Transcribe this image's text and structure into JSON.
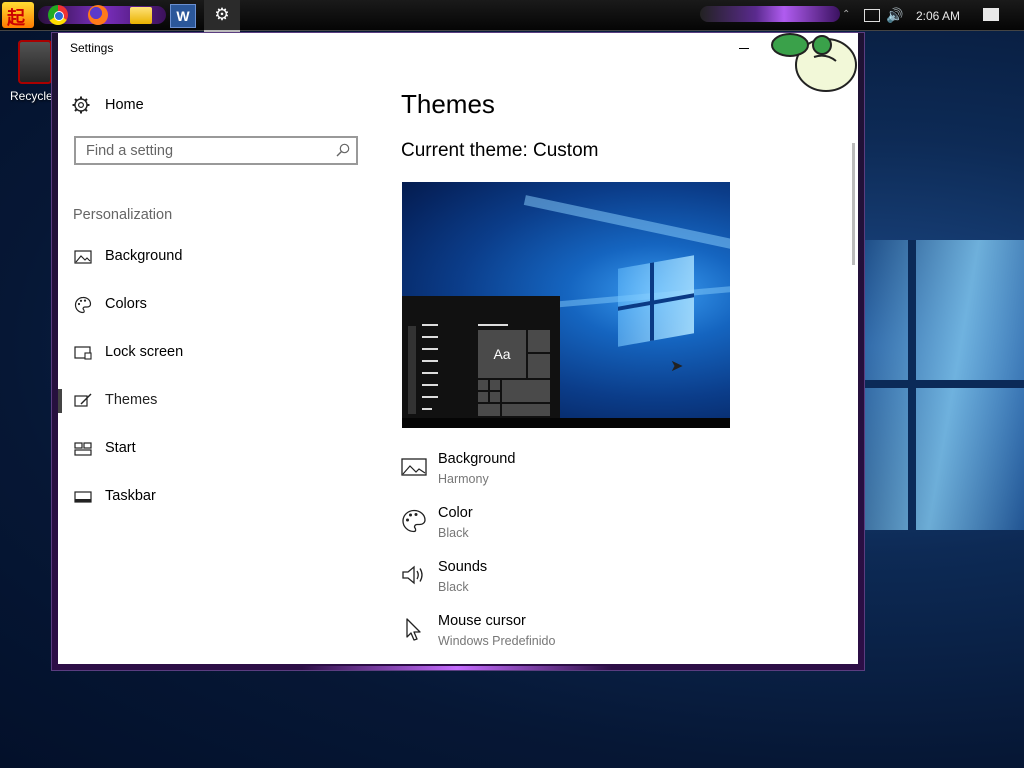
{
  "taskbar": {
    "clock": "2:06 AM",
    "apps": [
      "chrome-icon",
      "firefox-icon",
      "file-explorer-icon",
      "word-icon",
      "settings-icon"
    ]
  },
  "desktop": {
    "recycle_label": "Recycle"
  },
  "window": {
    "title": "Settings"
  },
  "nav": {
    "home": "Home",
    "search_placeholder": "Find a setting",
    "section": "Personalization",
    "items": [
      {
        "label": "Background",
        "icon": "picture-icon"
      },
      {
        "label": "Colors",
        "icon": "palette-icon"
      },
      {
        "label": "Lock screen",
        "icon": "lock-screen-icon"
      },
      {
        "label": "Themes",
        "icon": "themes-icon",
        "selected": true
      },
      {
        "label": "Start",
        "icon": "start-icon"
      },
      {
        "label": "Taskbar",
        "icon": "taskbar-icon"
      }
    ]
  },
  "main": {
    "title": "Themes",
    "current_theme": "Current theme: Custom",
    "preview_tile": "Aa",
    "settings": [
      {
        "label": "Background",
        "value": "Harmony",
        "icon": "picture-icon"
      },
      {
        "label": "Color",
        "value": "Black",
        "icon": "palette-icon"
      },
      {
        "label": "Sounds",
        "value": "Black",
        "icon": "speaker-icon"
      },
      {
        "label": "Mouse cursor",
        "value": "Windows Predefinido",
        "icon": "cursor-icon"
      }
    ]
  }
}
